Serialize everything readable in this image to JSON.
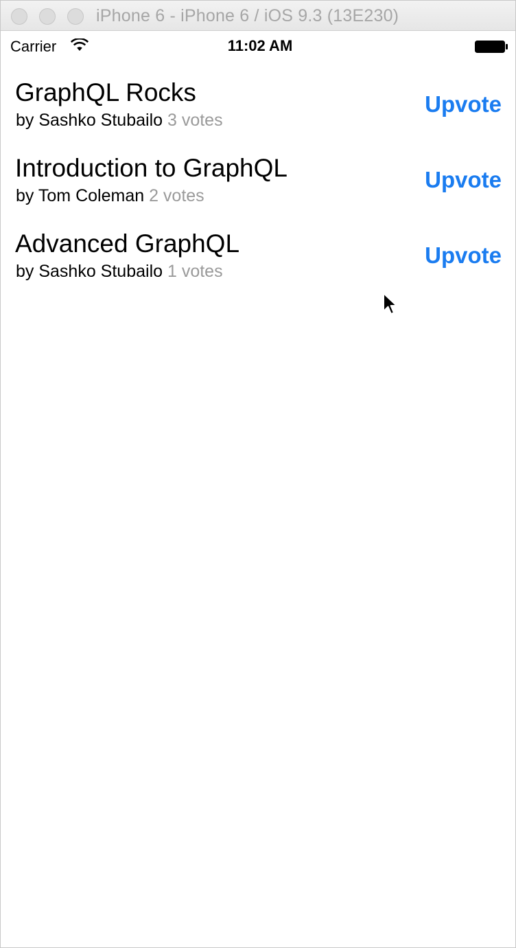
{
  "window": {
    "title": "iPhone 6 - iPhone 6 / iOS 9.3 (13E230)"
  },
  "status_bar": {
    "carrier": "Carrier",
    "time": "11:02 AM",
    "icons": [
      "wifi-icon",
      "battery-icon"
    ]
  },
  "posts": [
    {
      "title": "GraphQL Rocks",
      "author": "by Sashko Stubailo",
      "votes": "3 votes",
      "action": "Upvote"
    },
    {
      "title": "Introduction to GraphQL",
      "author": "by Tom Coleman",
      "votes": "2 votes",
      "action": "Upvote"
    },
    {
      "title": "Advanced GraphQL",
      "author": "by Sashko Stubailo",
      "votes": "1 votes",
      "action": "Upvote"
    }
  ],
  "colors": {
    "accent": "#1a7cf0",
    "muted_text": "#9a9a9a"
  }
}
